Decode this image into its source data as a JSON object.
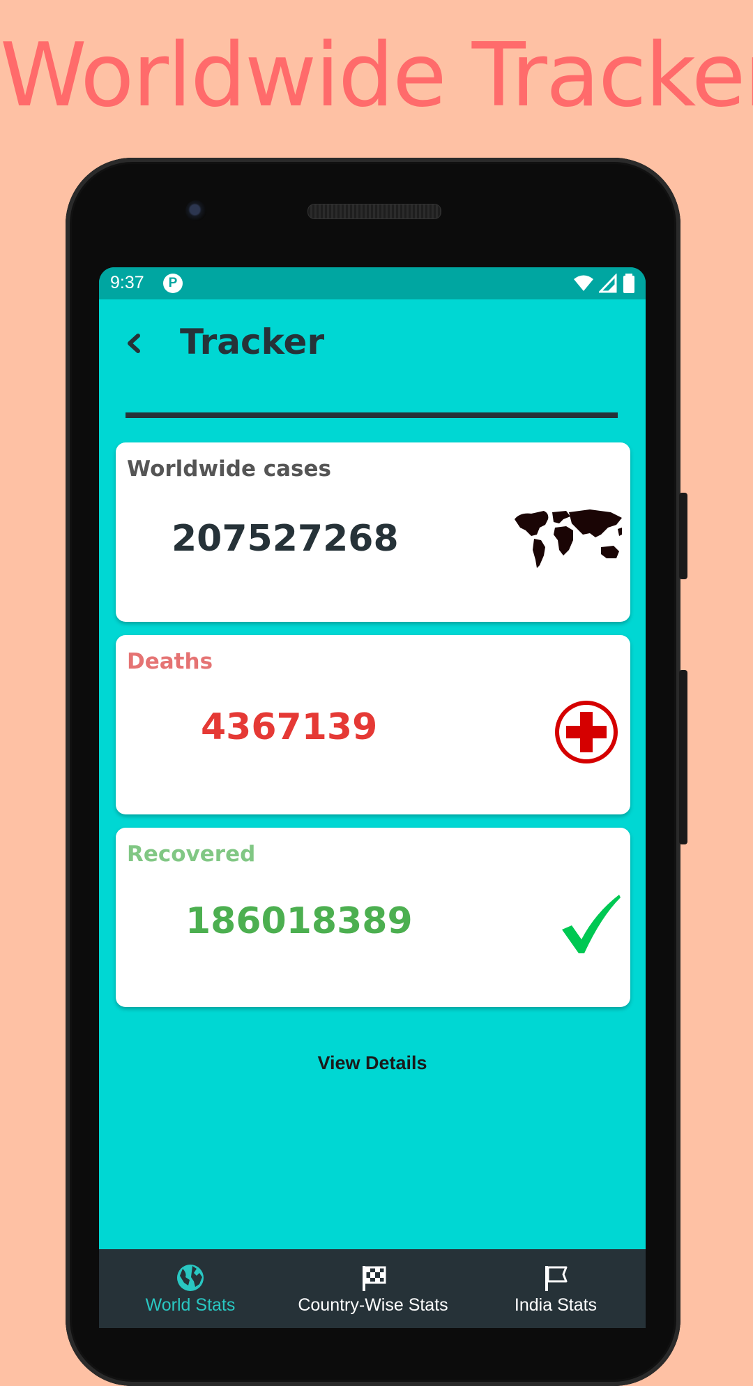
{
  "promo": {
    "title": "Worldwide Tracker"
  },
  "status_bar": {
    "time": "9:37",
    "notification_icon": "P"
  },
  "app_bar": {
    "back_icon": "‹",
    "title": "Tracker"
  },
  "cards": {
    "cases": {
      "label": "Worldwide cases",
      "value": "207527268",
      "icon": "world-map-icon",
      "color": "#263238",
      "label_color": "#555555"
    },
    "deaths": {
      "label": "Deaths",
      "value": "4367139",
      "icon": "red-cross-icon",
      "color": "#E53935",
      "label_color": "#E57373"
    },
    "recovered": {
      "label": "Recovered",
      "value": "186018389",
      "icon": "check-icon",
      "color": "#4CAF50",
      "label_color": "#81C784"
    }
  },
  "view_details": "View Details",
  "bottom_nav": {
    "items": [
      {
        "label": "World Stats",
        "icon": "globe-icon",
        "active": true
      },
      {
        "label": "Country-Wise Stats",
        "icon": "checkered-flag-icon",
        "active": false
      },
      {
        "label": "India Stats",
        "icon": "flag-icon",
        "active": false
      }
    ]
  },
  "colors": {
    "background": "#FEC1A4",
    "promo_title": "#FF6B6B",
    "screen": "#00D7D3",
    "status_bar": "#00A6A1",
    "nav_bar": "#263238",
    "nav_active": "#29C7C2"
  }
}
